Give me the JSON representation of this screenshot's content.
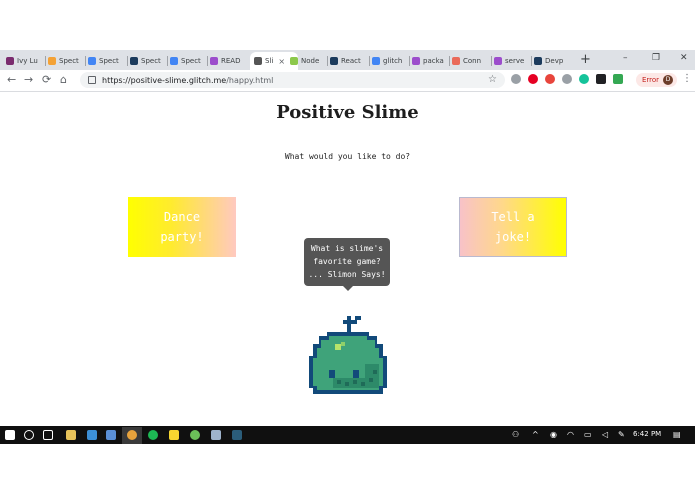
{
  "browser": {
    "tabs": [
      {
        "label": "Ivy Lu",
        "color": "#7b2c6e"
      },
      {
        "label": "Spect",
        "color": "#f4a236"
      },
      {
        "label": "Spect",
        "color": "#4285f4"
      },
      {
        "label": "Spect",
        "color": "#1b3a5c"
      },
      {
        "label": "Spect",
        "color": "#4285f4"
      },
      {
        "label": "READ",
        "color": "#9c4dcc"
      },
      {
        "label": "Sli",
        "color": "#555555",
        "active": true
      },
      {
        "label": "Node",
        "color": "#8cc84b"
      },
      {
        "label": "React",
        "color": "#1b3a5c"
      },
      {
        "label": "glitch",
        "color": "#4285f4"
      },
      {
        "label": "packa",
        "color": "#9c4dcc"
      },
      {
        "label": "Conn",
        "color": "#ea6a5a"
      },
      {
        "label": "serve",
        "color": "#9c4dcc"
      },
      {
        "label": "Devp",
        "color": "#1b3a5c"
      }
    ],
    "new_tab": "+",
    "tab_close": "×",
    "window_controls": {
      "minimize": "–",
      "restore": "❐",
      "close": "✕"
    },
    "nav": {
      "back": "←",
      "forward": "→",
      "reload": "⟳",
      "home": "⌂"
    },
    "url": {
      "host": "https://positive-slime.glitch.me",
      "path": "/happy.html"
    },
    "bookmark_icon": "star-icon",
    "bookmark_glyph": "☆",
    "error_label": "Error",
    "avatar_initial": "D",
    "menu_glyph": "⋮"
  },
  "page": {
    "title": "Positive Slime",
    "prompt": "What would you like to do?",
    "dance_button": {
      "line1": "Dance",
      "line2": "party!"
    },
    "joke_button": {
      "line1": "Tell a",
      "line2": "joke!"
    },
    "bubble": {
      "line1": "What is slime's",
      "line2": "favorite game?",
      "line3": "... Slimon Says!"
    }
  },
  "taskbar": {
    "time": "6:42 PM"
  }
}
